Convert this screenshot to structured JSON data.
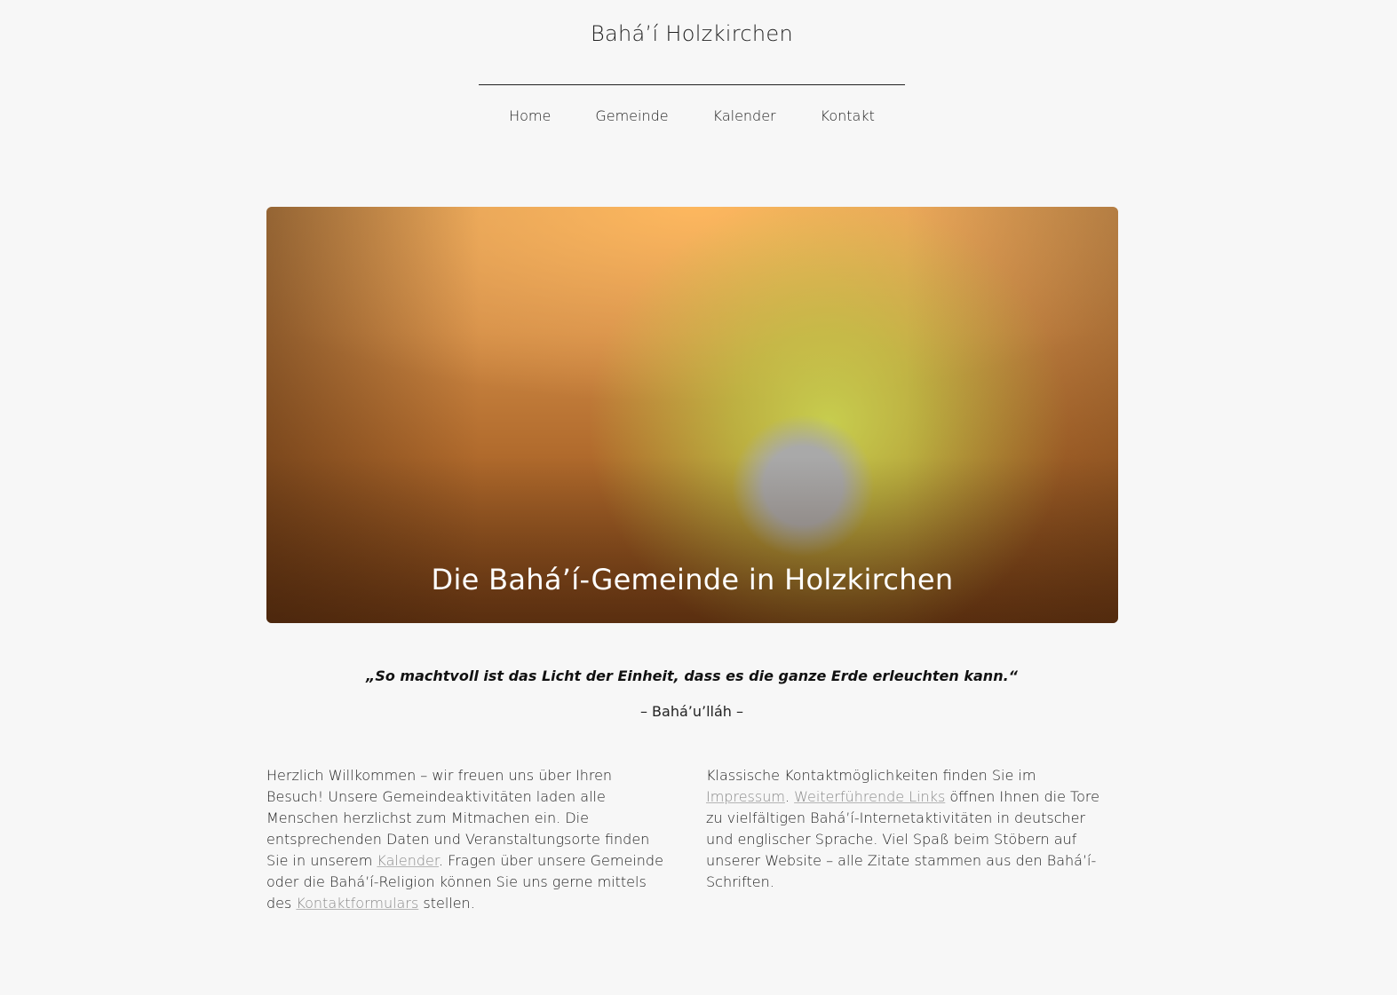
{
  "site": {
    "title": "Bahá’í Holzkirchen"
  },
  "nav": {
    "items": [
      {
        "label": "Home"
      },
      {
        "label": "Gemeinde"
      },
      {
        "label": "Kalender"
      },
      {
        "label": "Kontakt"
      }
    ]
  },
  "hero": {
    "title": "Die Bahá’í-Gemeinde in Holzkirchen"
  },
  "quote": {
    "text": "„So machtvoll ist das Licht der Einheit, dass es die ganze Erde erleuchten kann.“",
    "author": "– Bahá’u’lláh –"
  },
  "left_column": {
    "part1": "Herzlich Willkommen – wir freuen uns über Ihren Besuch! Unsere Gemeindeaktivitäten laden alle Menschen herzlichst zum Mitmachen ein. Die entsprechenden Daten und Veranstaltungsorte finden Sie in unserem ",
    "link1": "Kalender",
    "part2": ". Fragen über unsere Gemeinde oder die Bahá’í-Religion können Sie uns gerne mittels des ",
    "link2": "Kontaktformulars",
    "part3": " stellen."
  },
  "right_column": {
    "part1": "Klassische Kontaktmöglichkeiten finden Sie im ",
    "link1": "Impressum",
    "part2": ". ",
    "link2": "Weiterführende Links",
    "part3": " öffnen Ihnen die Tore zu vielfältigen Bahá’í-Internetaktivitäten in deutscher und englischer Sprache. Viel Spaß beim Stöbern auf unserer Website – alle Zitate stammen aus den Bahá’í-Schriften."
  }
}
